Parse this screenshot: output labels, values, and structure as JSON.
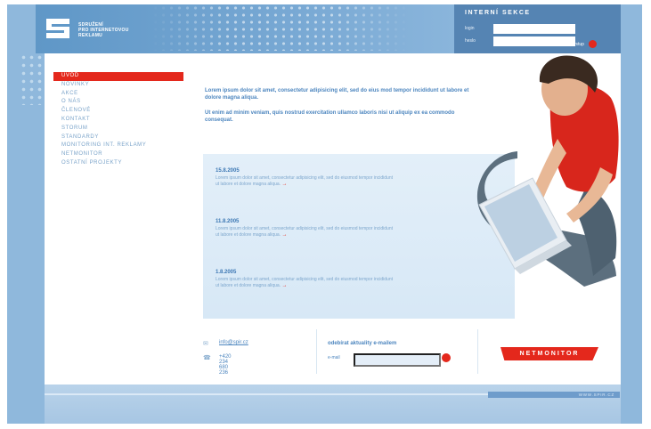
{
  "logo": {
    "lines": [
      "SDRUŽENÍ",
      "PRO INTERNETOVOU",
      "REKLAMU"
    ]
  },
  "login": {
    "title": "INTERNÍ SEKCE",
    "user_label": "login",
    "password_label": "heslo",
    "submit_label": "vstup"
  },
  "menu": {
    "items": [
      {
        "label": "ÚVOD"
      },
      {
        "label": "NOVINKY"
      },
      {
        "label": "AKCE"
      },
      {
        "label": "O NÁS"
      },
      {
        "label": "ČLENOVÉ"
      },
      {
        "label": "KONTAKT"
      },
      {
        "label": "STORUM"
      },
      {
        "label": "STANDARDY"
      },
      {
        "label": "MONITORING INT. REKLAMY"
      },
      {
        "label": "NETMONITOR"
      },
      {
        "label": "OSTATNÍ PROJEKTY"
      }
    ]
  },
  "intro": {
    "paragraph1": "Lorem ipsum dolor sit amet, consectetur adipisicing elit, sed do eius mod tempor incididunt ut labore et dolore magna aliqua.",
    "paragraph2": "Ut enim ad minim veniam, quis nostrud exercitation ullamco laboris nisi ut aliquip ex ea commodo consequat."
  },
  "news": [
    {
      "date": "15.8.2005",
      "text": "Lorem ipsum dolor sit amet, consectetur adipisicing elit, sed do eiusmod tempor incididunt ut labore et dolore magna aliqua.",
      "more": "→"
    },
    {
      "date": "11.8.2005",
      "text": "Lorem ipsum dolor sit amet, consectetur adipisicing elit, sed do eiusmod tempor incididunt ut labore et dolore magna aliqua.",
      "more": "→"
    },
    {
      "date": "1.8.2005",
      "text": "Lorem ipsum dolor sit amet, consectetur adipisicing elit, sed do eiusmod tempor incididunt ut labore et dolore magna aliqua.",
      "more": "→"
    }
  ],
  "contact": {
    "email": "info@spir.cz",
    "phone": "+420 234 680 236"
  },
  "subscribe": {
    "title": "odebírat aktuality e-mailem",
    "email_label": "e-mail"
  },
  "netmonitor": {
    "label": "NETMONITOR"
  },
  "footer": {
    "text": "WWW.SPIR.CZ"
  },
  "colors": {
    "accent": "#e4281c",
    "brand_blue": "#5f97c7",
    "link_blue": "#4d86bf",
    "frame": "#8fb8dc"
  }
}
